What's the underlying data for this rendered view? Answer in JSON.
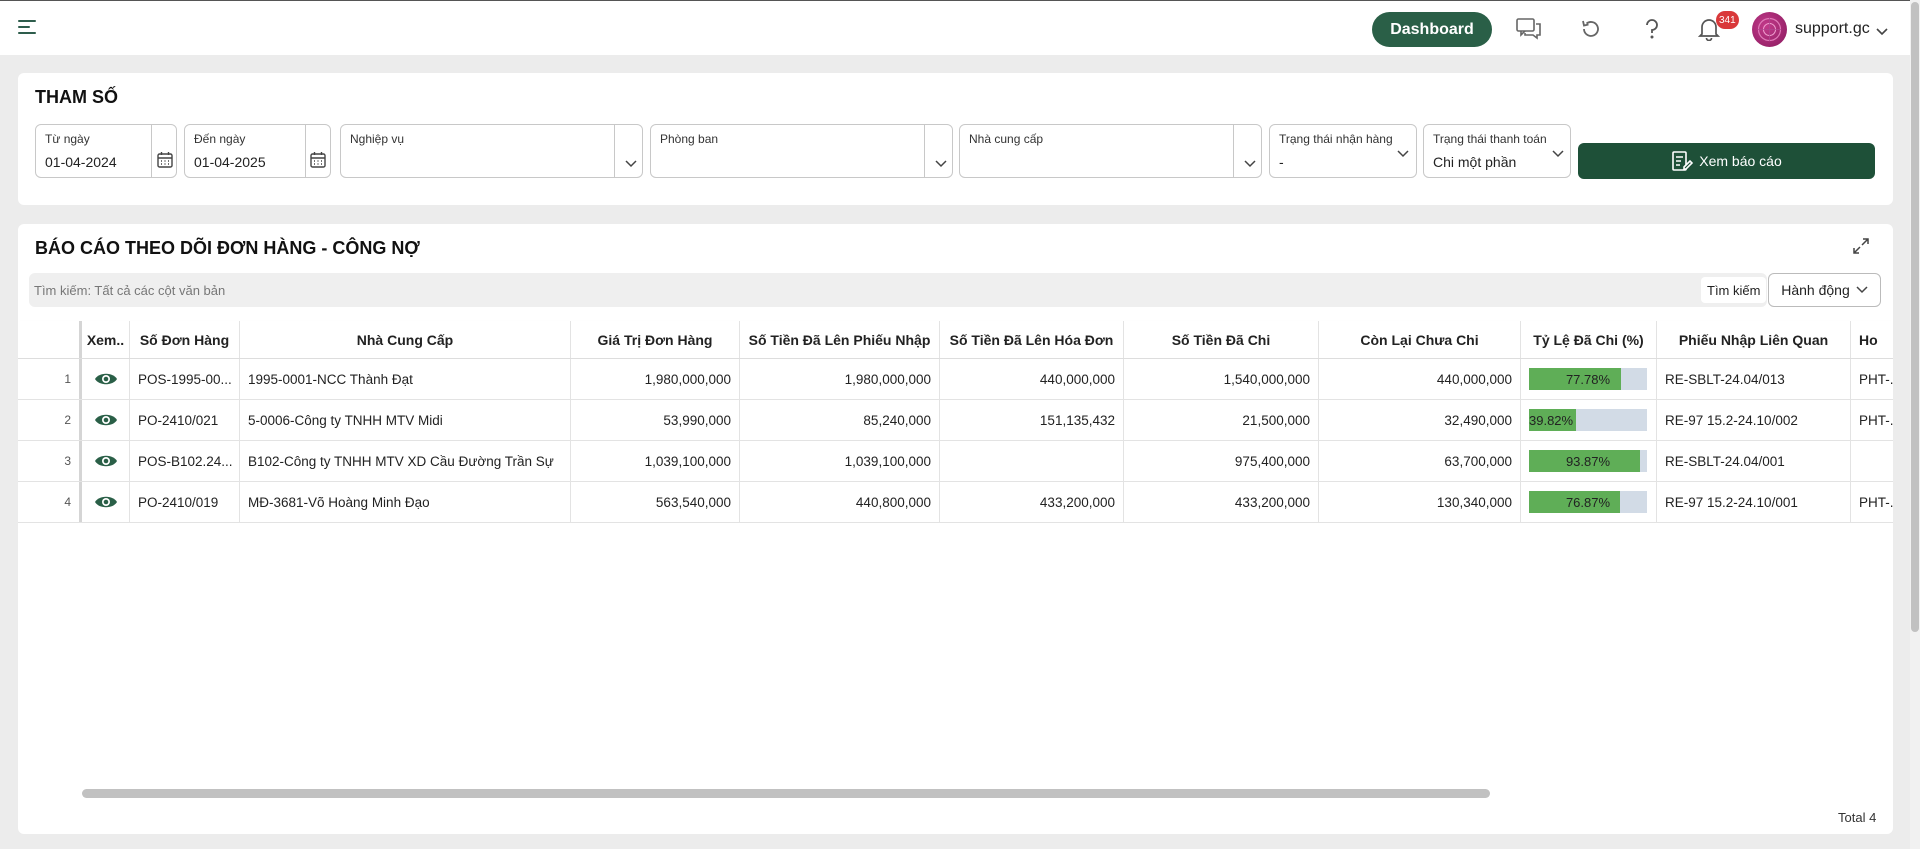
{
  "topbar": {
    "dashboard_label": "Dashboard",
    "notification_count": "341",
    "username": "support.gc",
    "icons": [
      "menu-icon",
      "chat-icon",
      "refresh-icon",
      "help-icon",
      "bell-icon",
      "chevron-down-icon"
    ]
  },
  "params": {
    "title": "THAM SỐ",
    "from_date": {
      "label": "Từ ngày",
      "value": "01-04-2024"
    },
    "to_date": {
      "label": "Đến ngày",
      "value": "01-04-2025"
    },
    "business": {
      "label": "Nghiệp vụ",
      "value": ""
    },
    "department": {
      "label": "Phòng ban",
      "value": ""
    },
    "supplier": {
      "label": "Nhà cung cấp",
      "value": ""
    },
    "receive_status": {
      "label": "Trạng thái nhận hàng",
      "value": "-"
    },
    "payment_status": {
      "label": "Trạng thái thanh toán",
      "value": "Chi một phần"
    },
    "report_button": "Xem báo cáo"
  },
  "report": {
    "title": "BÁO CÁO THEO DÕI ĐƠN HÀNG - CÔNG NỢ",
    "search_placeholder": "Tìm kiếm: Tất cả các cột văn bản",
    "search_button": "Tìm kiếm",
    "action_button": "Hành động",
    "total": "Total 4",
    "columns": [
      "",
      "Xem..",
      "Số Đơn Hàng",
      "Nhà Cung Cấp",
      "Giá Trị Đơn Hàng",
      "Số Tiền Đã Lên Phiếu Nhập",
      "Số Tiền Đã Lên Hóa Đơn",
      "Số Tiền Đã Chi",
      "Còn Lại Chưa Chi",
      "Tỷ Lệ Đã Chi (%)",
      "Phiếu Nhập Liên Quan",
      "Ho"
    ],
    "rows": [
      {
        "no": "1",
        "order": "POS-1995-00...",
        "supplier": "1995-0001-NCC Thành Đạt",
        "order_value": "1,980,000,000",
        "receipt_amount": "1,980,000,000",
        "invoice_amount": "440,000,000",
        "paid": "1,540,000,000",
        "remaining": "440,000,000",
        "ratio": 77.78,
        "ratio_label": "77.78%",
        "receipt_ref": "RE-SBLT-24.04/013",
        "extra": "PHT-..."
      },
      {
        "no": "2",
        "order": "PO-2410/021",
        "supplier": "5-0006-Công ty TNHH MTV Midi",
        "order_value": "53,990,000",
        "receipt_amount": "85,240,000",
        "invoice_amount": "151,135,432",
        "paid": "21,500,000",
        "remaining": "32,490,000",
        "ratio": 39.82,
        "ratio_label": "39.82%",
        "receipt_ref": "RE-97 15.2-24.10/002",
        "extra": "PHT-..."
      },
      {
        "no": "3",
        "order": "POS-B102.24...",
        "supplier": "B102-Công ty TNHH MTV XD Cầu Đường Trần Sự",
        "order_value": "1,039,100,000",
        "receipt_amount": "1,039,100,000",
        "invoice_amount": "",
        "paid": "975,400,000",
        "remaining": "63,700,000",
        "ratio": 93.87,
        "ratio_label": "93.87%",
        "receipt_ref": "RE-SBLT-24.04/001",
        "extra": ""
      },
      {
        "no": "4",
        "order": "PO-2410/019",
        "supplier": "MĐ-3681-Võ Hoàng Minh Đạo",
        "order_value": "563,540,000",
        "receipt_amount": "440,800,000",
        "invoice_amount": "433,200,000",
        "paid": "433,200,000",
        "remaining": "130,340,000",
        "ratio": 76.87,
        "ratio_label": "76.87%",
        "receipt_ref": "RE-97 15.2-24.10/001",
        "extra": "PHT-..."
      }
    ]
  },
  "colors": {
    "primary": "#2a5f47",
    "report_button": "#1e5038",
    "progress_fill": "#5fae57",
    "progress_track": "#d2dbe6",
    "badge": "#d9383a"
  }
}
